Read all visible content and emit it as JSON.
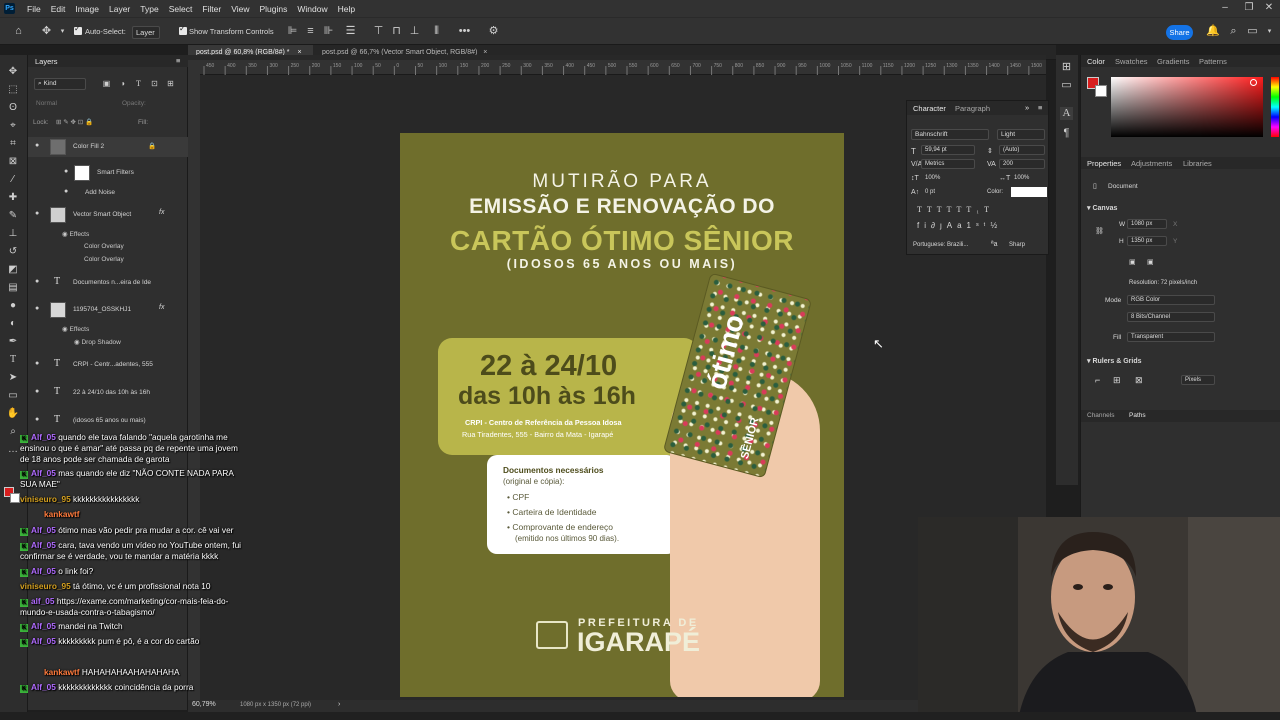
{
  "menubar": {
    "items": [
      "File",
      "Edit",
      "Image",
      "Layer",
      "Type",
      "Select",
      "Filter",
      "View",
      "Plugins",
      "Window",
      "Help"
    ],
    "app_icon": "photoshop-logo"
  },
  "options": {
    "auto_select_label": "Auto-Select:",
    "auto_select_value": "Layer",
    "show_transform_label": "Show Transform Controls",
    "share_label": "Share"
  },
  "doc_tabs": [
    {
      "label": "post.psd @ 60,8% (RGB/8#) *",
      "active": true
    },
    {
      "label": "post.psd @ 66,7% (Vector Smart Object, RGB/8#)",
      "active": false
    }
  ],
  "layers_panel": {
    "title": "Layers",
    "filter_label": "Kind",
    "mode_label": "Normal",
    "opacity_label": "Opacity:",
    "lock_label": "Lock:",
    "fill_label": "Fill:",
    "rows": [
      {
        "name": "Color Fill 2",
        "type": "fill"
      },
      {
        "name": "Smart Filters",
        "type": "sub"
      },
      {
        "name": "Add Noise",
        "type": "sub"
      },
      {
        "name": "Vector Smart Object",
        "type": "smart"
      },
      {
        "name": "Effects",
        "type": "sub"
      },
      {
        "name": "Color Overlay",
        "type": "sub"
      },
      {
        "name": "Color Overlay",
        "type": "sub"
      },
      {
        "name": "Documentos n...eira de Ide",
        "type": "text"
      },
      {
        "name": "1195704_OSSKHJ1",
        "type": "smart"
      },
      {
        "name": "Effects",
        "type": "sub"
      },
      {
        "name": "Drop Shadow",
        "type": "sub"
      },
      {
        "name": "CRPI - Centr...adentes, 555",
        "type": "text"
      },
      {
        "name": "22 à 24/10 das 10h às 16h",
        "type": "text"
      },
      {
        "name": "(idosos 65 anos ou mais)",
        "type": "text"
      }
    ]
  },
  "chat": [
    {
      "user": "Alf_05",
      "user_color": "#b06bff",
      "text": "quando ele tava falando \"aquela garotinha me"
    },
    {
      "user": "",
      "user_color": "#fff",
      "text": "ensinou o que é amar\" até passa pq de repente uma jovem"
    },
    {
      "user": "",
      "user_color": "#fff",
      "text": "de 18 anos pode ser chamada de garota"
    },
    {
      "user": "Alf_05",
      "user_color": "#b06bff",
      "text": "mas quando ele diz \"NÃO CONTE NADA PARA"
    },
    {
      "user": "",
      "user_color": "#fff",
      "text": "SUA MAE\""
    },
    {
      "user": "viniseuro_95",
      "user_color": "#d4a020",
      "text": "kkkkkkkkkkkkkkkk"
    },
    {
      "user": "kankawtf",
      "user_color": "#ff7a3c",
      "text": ""
    },
    {
      "user": "Alf_05",
      "user_color": "#b06bff",
      "text": "ótimo mas vão pedir pra mudar a cor. cê vai ver"
    },
    {
      "user": "Alf_05",
      "user_color": "#b06bff",
      "text": "cara, tava vendo um vídeo no YouTube ontem, fui"
    },
    {
      "user": "",
      "user_color": "#fff",
      "text": "confirmar se é verdade, vou te mandar a matéria kkkk"
    },
    {
      "user": "Alf_05",
      "user_color": "#b06bff",
      "text": "o link foi?"
    },
    {
      "user": "viniseuro_95",
      "user_color": "#d4a020",
      "text": "tá ótimo, vc é um profissional nota 10"
    },
    {
      "user": "alf_05",
      "user_color": "#b06bff",
      "text": "https://exame.com/marketing/cor-mais-feia-do-"
    },
    {
      "user": "",
      "user_color": "#fff",
      "text": "mundo-e-usada-contra-o-tabagismo/"
    },
    {
      "user": "Alf_05",
      "user_color": "#b06bff",
      "text": "mandei na Twitch"
    },
    {
      "user": "Alf_05",
      "user_color": "#b06bff",
      "text": "kkkkkkkkk pum é pô, é a cor do cartão"
    },
    {
      "user": "kankawtf",
      "user_color": "#ff7a3c",
      "text": "HAHAHAHAAHAHAHAHA"
    },
    {
      "user": "Alf_05",
      "user_color": "#b06bff",
      "text": "kkkkkkkkkkkkk coincidência da porra"
    }
  ],
  "poster": {
    "line1": "MUTIRÃO PARA",
    "line2": "EMISSÃO E RENOVAÇÃO DO",
    "line3": "CARTÃO ÓTIMO SÊNIOR",
    "line4": "(IDOSOS 65 ANOS OU MAIS)",
    "date": "22 à 24/10",
    "time": "das 10h às 16h",
    "address1": "CRPI - Centro de Referência da Pessoa Idosa",
    "address2": "Rua Tiradentes, 555 - Bairro da Mata - Igarapé",
    "docs_title": "Documentos necessários",
    "docs_sub": "(original e cópia):",
    "docs": [
      "CPF",
      "Carteira de Identidade",
      "Comprovante de endereço",
      "(emitido nos últimos 90 dias)."
    ],
    "card_brand": "ótimo",
    "card_label": "SÊNIOR",
    "footer_small": "PREFEITURA DE",
    "footer_big": "IGARAPÉ",
    "background_color": "#6f6e2c",
    "accent_color": "#b8b54a"
  },
  "character_panel": {
    "tabs": [
      "Character",
      "Paragraph"
    ],
    "font_family": "Bahnschrift",
    "font_style": "Light",
    "font_size": "59,94 pt",
    "leading": "(Auto)",
    "kerning": "Metrics",
    "tracking": "200",
    "v_scale": "100%",
    "h_scale": "100%",
    "baseline": "0 pt",
    "color_label": "Color:",
    "language": "Portuguese: Brazili...",
    "antialias": "Sharp"
  },
  "right_panel": {
    "color_tabs": [
      "Color",
      "Swatches",
      "Gradients",
      "Patterns"
    ],
    "props_tabs": [
      "Properties",
      "Adjustments",
      "Libraries"
    ],
    "document_label": "Document",
    "canvas_title": "Canvas",
    "width_label": "W",
    "width_value": "1080 px",
    "height_label": "H",
    "height_value": "1350 px",
    "x_label": "X",
    "y_label": "Y",
    "resolution": "Resolution: 72 pixels/inch",
    "mode_label": "Mode",
    "mode_value": "RGB Color",
    "bits_value": "8 Bits/Channel",
    "fill_label": "Fill",
    "fill_value": "Transparent",
    "rulers_title": "Rulers & Grids",
    "units_value": "Pixels",
    "bottom_tabs": [
      "Channels",
      "Paths"
    ]
  },
  "status": {
    "zoom": "60,79%",
    "doc_size": "1080 px x 1350 px (72 ppi)"
  },
  "ruler_ticks": [
    "450",
    "400",
    "350",
    "300",
    "250",
    "200",
    "150",
    "100",
    "50",
    "0",
    "50",
    "100",
    "150",
    "200",
    "250",
    "300",
    "350",
    "400",
    "450",
    "500",
    "550",
    "600",
    "650",
    "700",
    "750",
    "800",
    "850",
    "900",
    "950",
    "1000",
    "1050",
    "1100",
    "1150",
    "1200",
    "1250",
    "1300",
    "1350",
    "1400",
    "1450",
    "1500"
  ]
}
